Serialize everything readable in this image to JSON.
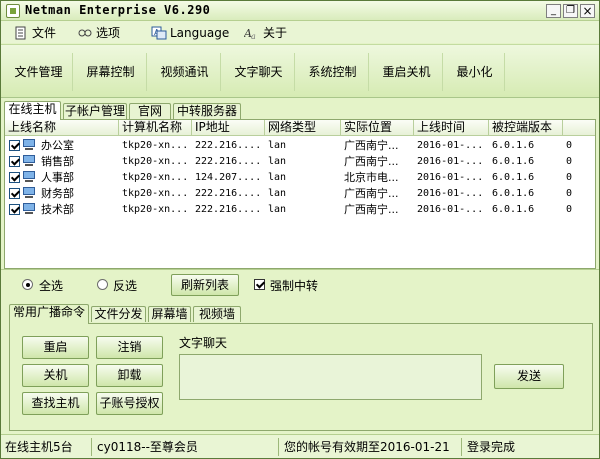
{
  "window": {
    "title": "Netman Enterprise V6.290",
    "minimize": "_",
    "restore": "❐",
    "close": "×"
  },
  "menu": [
    {
      "label": "文件",
      "icon": "file-icon"
    },
    {
      "label": "选项",
      "icon": "options-icon"
    },
    {
      "label": "Language",
      "icon": "language-icon"
    },
    {
      "label": "关于",
      "icon": "about-icon"
    }
  ],
  "toolbar": [
    "文件管理",
    "屏幕控制",
    "视频通讯",
    "文字聊天",
    "系统控制",
    "重启关机",
    "最小化"
  ],
  "tabs_top": [
    "在线主机",
    "子帐户管理",
    "官网",
    "中转服务器"
  ],
  "columns": [
    "上线名称",
    "计算机名称",
    "IP地址",
    "网络类型",
    "实际位置",
    "上线时间",
    "被控端版本"
  ],
  "rows": [
    {
      "name": "办公室",
      "computer": "tkp20-xn...",
      "ip": "222.216....",
      "net": "lan",
      "location": "广西南宁...",
      "time": "2016-01-...",
      "version": "6.0.1.6",
      "extra": "0"
    },
    {
      "name": "销售部",
      "computer": "tkp20-xn...",
      "ip": "222.216....",
      "net": "lan",
      "location": "广西南宁...",
      "time": "2016-01-...",
      "version": "6.0.1.6",
      "extra": "0"
    },
    {
      "name": "人事部",
      "computer": "tkp20-xn...",
      "ip": "124.207....",
      "net": "lan",
      "location": "北京市电...",
      "time": "2016-01-...",
      "version": "6.0.1.6",
      "extra": "0"
    },
    {
      "name": "财务部",
      "computer": "tkp20-xn...",
      "ip": "222.216....",
      "net": "lan",
      "location": "广西南宁...",
      "time": "2016-01-...",
      "version": "6.0.1.6",
      "extra": "0"
    },
    {
      "name": "技术部",
      "computer": "tkp20-xn...",
      "ip": "222.216....",
      "net": "lan",
      "location": "广西南宁...",
      "time": "2016-01-...",
      "version": "6.0.1.6",
      "extra": "0"
    }
  ],
  "options": {
    "select_all": "全选",
    "invert": "反选",
    "refresh": "刷新列表",
    "force_relay": "强制中转"
  },
  "tabs_bottom": [
    "常用广播命令",
    "文件分发",
    "屏幕墙",
    "视频墙"
  ],
  "commands": [
    "重启",
    "注销",
    "关机",
    "卸载",
    "查找主机",
    "子账号授权"
  ],
  "chat": {
    "label": "文字聊天",
    "send": "发送"
  },
  "status": {
    "online": "在线主机5台",
    "user": "cy0118--至尊会员",
    "expiry": "您的帐号有效期至2016-01-21",
    "login": "登录完成"
  },
  "colors": {
    "background": "#e4f3c8",
    "border": "#8ea86d"
  }
}
